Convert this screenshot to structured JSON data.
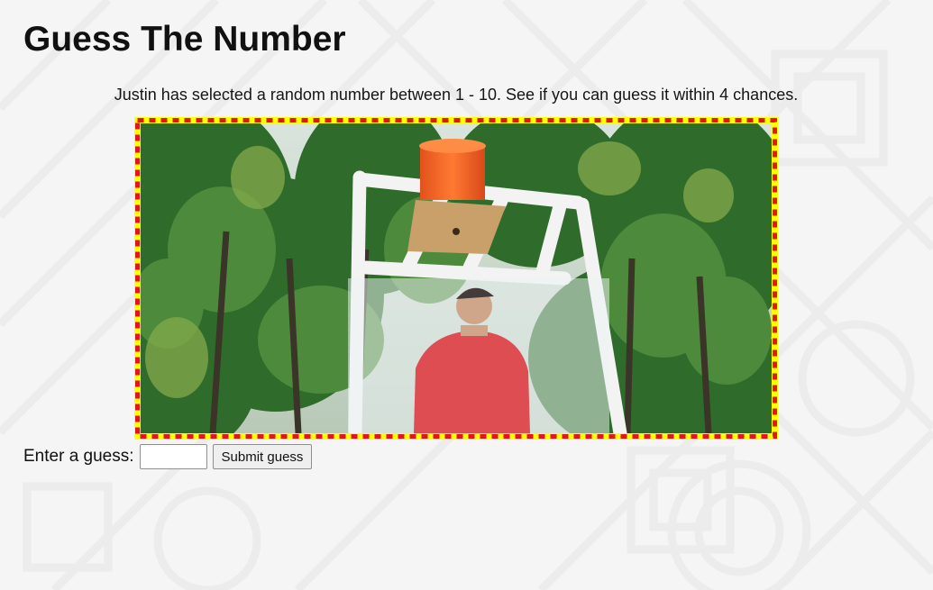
{
  "page": {
    "title": "Guess The Number",
    "intro": "Justin has selected a random number between 1 - 10. See if you can guess it within 4 chances."
  },
  "image": {
    "frame_colors": [
      "#ffff00",
      "#e0161b"
    ]
  },
  "form": {
    "label": "Enter a guess:",
    "input_value": "",
    "submit_label": "Submit guess"
  }
}
